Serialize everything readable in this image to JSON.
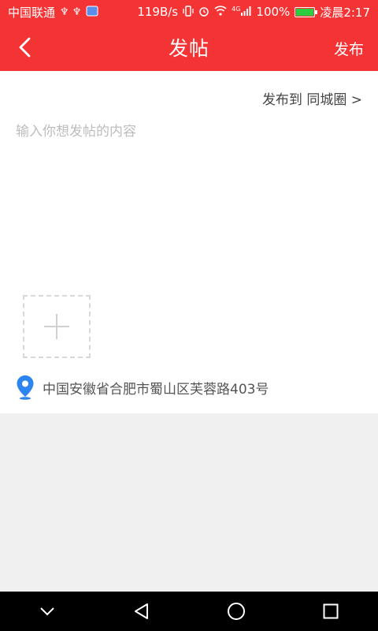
{
  "status_bar": {
    "carrier": "中国联通",
    "usb_icons": "♆ ♆",
    "speed": "119B/s",
    "signal": "4G",
    "battery": "100%",
    "time": "凌晨2:17"
  },
  "header": {
    "title": "发帖",
    "publish_label": "发布"
  },
  "post": {
    "publish_to": "发布到 同城圈 >",
    "placeholder": "输入你想发帖的内容",
    "location": "中国安徽省合肥市蜀山区芙蓉路403号"
  },
  "colors": {
    "brand": "#f43335",
    "location_pin": "#2b84f0"
  },
  "icons": {
    "back": "back-icon",
    "add_image": "plus-icon",
    "location": "location-pin-icon",
    "nav_collapse": "chevron-down-icon",
    "nav_back": "triangle-back-icon",
    "nav_home": "circle-home-icon",
    "nav_recent": "square-recent-icon"
  }
}
